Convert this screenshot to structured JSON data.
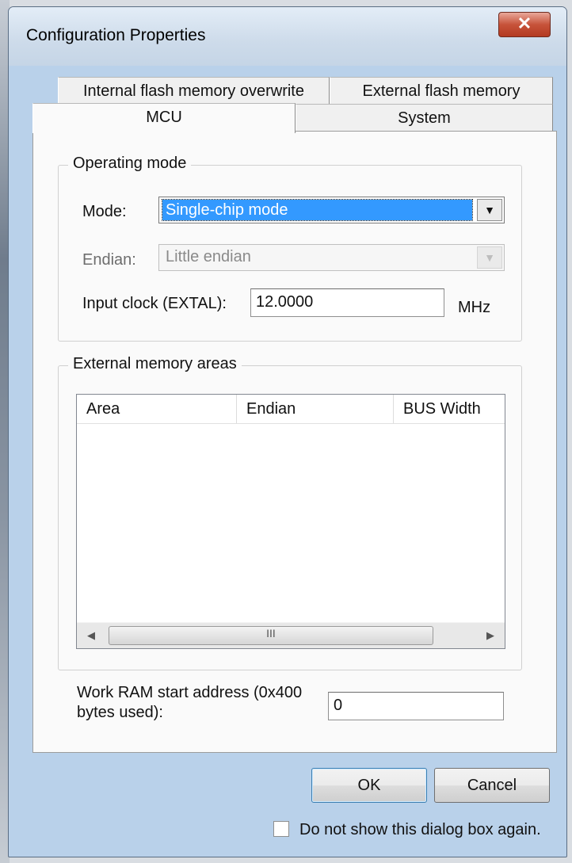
{
  "window": {
    "title": "Configuration Properties",
    "close_glyph": "✕"
  },
  "tabs": {
    "row1": [
      "Internal flash memory overwrite",
      "External flash memory"
    ],
    "row2": [
      "MCU",
      "System"
    ],
    "selected": "MCU"
  },
  "operating_mode": {
    "legend": "Operating mode",
    "mode_label": "Mode:",
    "mode_value": "Single-chip mode",
    "endian_label": "Endian:",
    "endian_value": "Little endian",
    "clock_label": "Input clock (EXTAL):",
    "clock_value": "12.0000",
    "clock_unit": "MHz"
  },
  "external_memory": {
    "legend": "External memory areas",
    "columns": [
      "Area",
      "Endian",
      "BUS Width"
    ],
    "rows": [],
    "scroll_left": "◀",
    "scroll_right": "▶",
    "thumb_grip": "III"
  },
  "work_ram": {
    "label_line1": "Work RAM start address (0x400",
    "label_line2": "bytes used):",
    "value": "0"
  },
  "buttons": {
    "ok": "OK",
    "cancel": "Cancel"
  },
  "dont_show": {
    "label": "Do not show this dialog box again.",
    "checked": false
  },
  "icons": {
    "dropdown": "chevron-down-icon",
    "close": "close-icon"
  }
}
